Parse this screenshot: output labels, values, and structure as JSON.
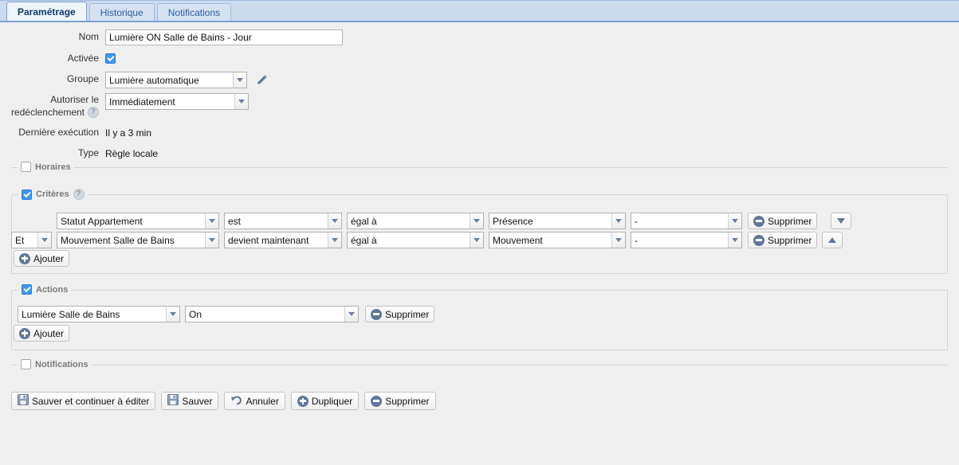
{
  "tabs": [
    {
      "label": "Paramétrage",
      "active": true
    },
    {
      "label": "Historique",
      "active": false
    },
    {
      "label": "Notifications",
      "active": false
    }
  ],
  "form": {
    "nom": {
      "label": "Nom",
      "value": "Lumière ON Salle de Bains - Jour"
    },
    "activee": {
      "label": "Activée",
      "checked": true
    },
    "groupe": {
      "label": "Groupe",
      "value": "Lumière automatique"
    },
    "redeclenchement": {
      "label_line1": "Autoriser le",
      "label_line2": "redéclenchement",
      "value": "Immédiatement",
      "help": "?"
    },
    "derniere_execution": {
      "label": "Dernière exécution",
      "value": "Il y a 3 min"
    },
    "type": {
      "label": "Type",
      "value": "Règle locale"
    }
  },
  "sections": {
    "horaires": {
      "label": "Horaires",
      "checked": false
    },
    "criteres": {
      "label": "Critères",
      "checked": true,
      "help": "?"
    },
    "actions": {
      "label": "Actions",
      "checked": true
    },
    "notifications": {
      "label": "Notifications",
      "checked": false
    }
  },
  "criteria": {
    "rows": [
      {
        "logic": "",
        "subject": "Statut Appartement",
        "verb": "est",
        "comparator": "égal à",
        "value": "Présence",
        "extra": "-",
        "delete_label": "Supprimer",
        "move": "down"
      },
      {
        "logic": "Et",
        "subject": "Mouvement Salle de Bains",
        "verb": "devient maintenant",
        "comparator": "égal à",
        "value": "Mouvement",
        "extra": "-",
        "delete_label": "Supprimer",
        "move": "up"
      }
    ],
    "add_label": "Ajouter"
  },
  "actions": {
    "rows": [
      {
        "target": "Lumière Salle de Bains",
        "command": "On",
        "delete_label": "Supprimer"
      }
    ],
    "add_label": "Ajouter"
  },
  "toolbar": {
    "save_continue_label": "Sauver et continuer à éditer",
    "save_label": "Sauver",
    "cancel_label": "Annuler",
    "duplicate_label": "Dupliquer",
    "delete_label": "Supprimer"
  },
  "colors": {
    "tabbar_bg": "#ccdaee",
    "tab_active_bg": "#eff5fc",
    "accent_blue": "#3b97f3",
    "icon_slate": "#5f7799",
    "page_bg": "#efefef"
  }
}
